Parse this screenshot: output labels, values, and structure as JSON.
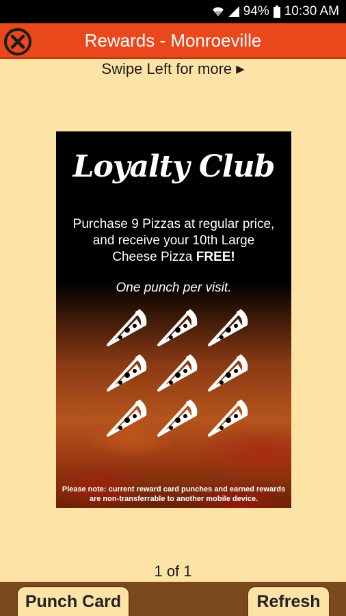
{
  "status": {
    "battery": "94%",
    "time": "10:30 AM",
    "icons": [
      "wifi-icon",
      "signal-icon",
      "battery-icon"
    ]
  },
  "header": {
    "title": "Rewards - Monroeville",
    "close_icon": "close-circle-icon",
    "accent_color": "#e8481c"
  },
  "swipe_hint": {
    "text": "Swipe Left for more",
    "icon": "triangle-right-icon"
  },
  "card": {
    "headline": "Loyalty Club",
    "description_main": "Purchase 9 Pizzas at regular price, and receive your 10th Large Cheese Pizza ",
    "description_bold": "FREE!",
    "subtext": "One punch per visit.",
    "punch_count": 9,
    "punch_icon": "pizza-slice-icon",
    "note": "Please note: current reward card punches and earned rewards are non-transferrable to another mobile device."
  },
  "pager": {
    "text": "1 of 1"
  },
  "footer": {
    "punch_card_label": "Punch Card",
    "refresh_label": "Refresh",
    "bar_color": "#7a4a1d"
  }
}
